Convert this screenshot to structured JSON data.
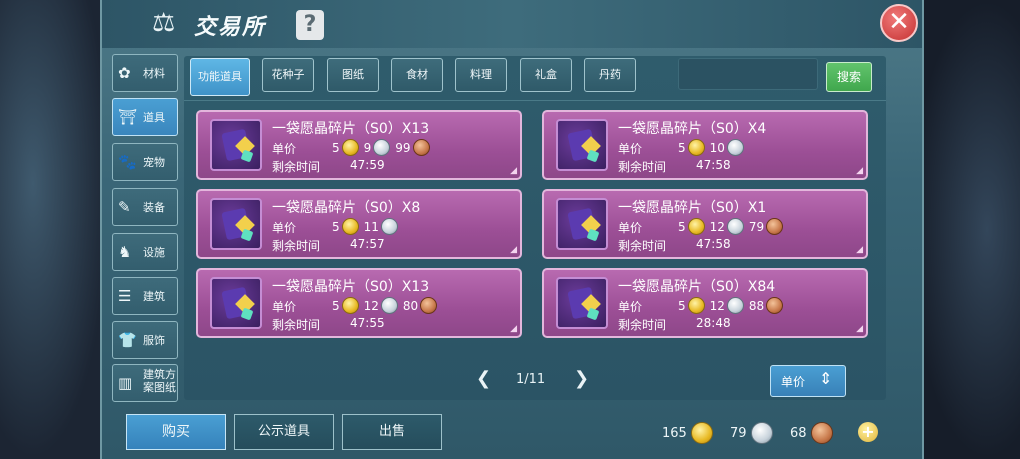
{
  "window": {
    "title": "交易所",
    "help_label": "?",
    "close_label": "✕"
  },
  "sidebar": {
    "items": [
      {
        "label": "材料",
        "icon": "✿"
      },
      {
        "label": "道具",
        "icon": "⛩"
      },
      {
        "label": "宠物",
        "icon": "🐾"
      },
      {
        "label": "装备",
        "icon": "✎"
      },
      {
        "label": "设施",
        "icon": "♞"
      },
      {
        "label": "建筑",
        "icon": "☰"
      },
      {
        "label": "服饰",
        "icon": "👕"
      },
      {
        "label": "建筑方案图纸",
        "icon": "▥"
      }
    ],
    "active_index": 1
  },
  "tabs": {
    "items": [
      {
        "label": "功能道具"
      },
      {
        "label": "花种子"
      },
      {
        "label": "图纸"
      },
      {
        "label": "食材"
      },
      {
        "label": "料理"
      },
      {
        "label": "礼盒"
      },
      {
        "label": "丹药"
      }
    ],
    "active_index": 0
  },
  "search": {
    "value": "",
    "placeholder": "",
    "button_label": "搜索"
  },
  "listings": [
    {
      "name": "一袋愿晶碎片（S0）X13",
      "price_label": "单价",
      "gold": "5",
      "silver": "9",
      "copper": "99",
      "time_label": "剩余时间",
      "time": "47:59"
    },
    {
      "name": "一袋愿晶碎片（S0）X4",
      "price_label": "单价",
      "gold": "5",
      "silver": "10",
      "copper": "",
      "time_label": "剩余时间",
      "time": "47:58"
    },
    {
      "name": "一袋愿晶碎片（S0）X8",
      "price_label": "单价",
      "gold": "5",
      "silver": "11",
      "copper": "",
      "time_label": "剩余时间",
      "time": "47:57"
    },
    {
      "name": "一袋愿晶碎片（S0）X1",
      "price_label": "单价",
      "gold": "5",
      "silver": "12",
      "copper": "79",
      "time_label": "剩余时间",
      "time": "47:58"
    },
    {
      "name": "一袋愿晶碎片（S0）X13",
      "price_label": "单价",
      "gold": "5",
      "silver": "12",
      "copper": "80",
      "time_label": "剩余时间",
      "time": "47:55"
    },
    {
      "name": "一袋愿晶碎片（S0）X84",
      "price_label": "单价",
      "gold": "5",
      "silver": "12",
      "copper": "88",
      "time_label": "剩余时间",
      "time": "28:48"
    }
  ],
  "pager": {
    "text": "1/11",
    "prev": "❮",
    "next": "❯"
  },
  "sort": {
    "label": "单价",
    "icon": "⇕"
  },
  "bottom": {
    "buy_label": "购买",
    "publicize_label": "公示道具",
    "sell_label": "出售"
  },
  "wallet": {
    "gold": "165",
    "silver": "79",
    "copper": "68",
    "plus": "+"
  },
  "colors": {
    "card_bg": "#a85aa2",
    "accent_blue": "#4a9fd3",
    "search_green": "#4caf50",
    "close_red": "#c53131"
  }
}
